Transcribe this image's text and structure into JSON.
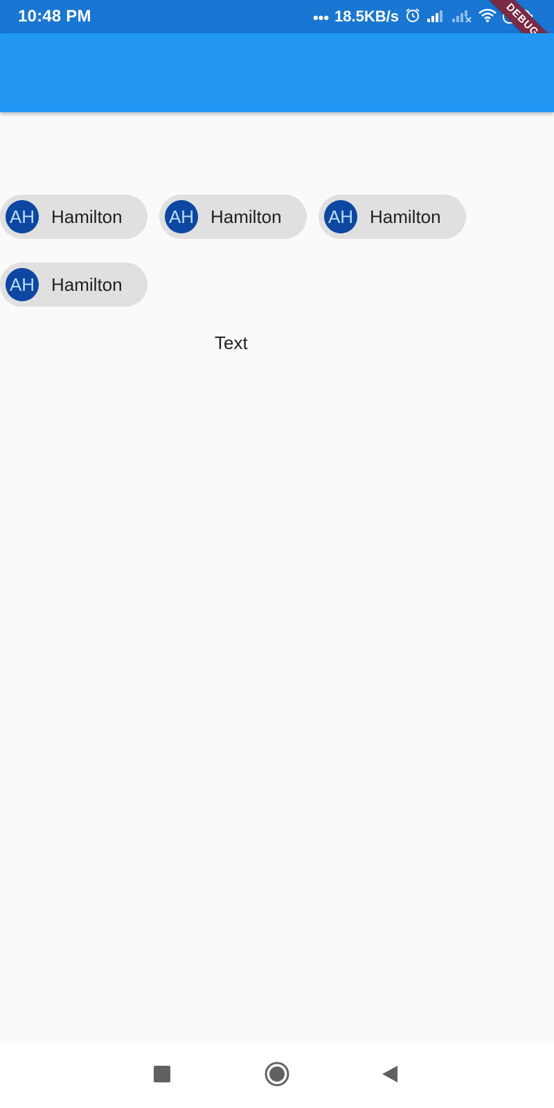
{
  "status_bar": {
    "time": "10:48 PM",
    "network_dots": "•••",
    "network_speed": "18.5KB/s",
    "battery_level": "24",
    "debug_label": "DEBUG",
    "icons": [
      "alarm-icon",
      "signal-icon",
      "signal-no-service-icon",
      "wifi-icon",
      "battery-icon"
    ]
  },
  "chips": [
    {
      "avatar_text": "AH",
      "label": "Hamilton"
    },
    {
      "avatar_text": "AH",
      "label": "Hamilton"
    },
    {
      "avatar_text": "AH",
      "label": "Hamilton"
    },
    {
      "avatar_text": "AH",
      "label": "Hamilton"
    }
  ],
  "body_text": "Text",
  "nav_bar": {
    "icons": [
      "recents-square-icon",
      "home-circle-icon",
      "back-triangle-icon"
    ]
  },
  "colors": {
    "status_bar": "#1976d2",
    "app_bar": "#2196f3",
    "chip_background": "#e0e0e0",
    "avatar_background": "#0d47a1",
    "debug_banner": "#7a2a45"
  }
}
